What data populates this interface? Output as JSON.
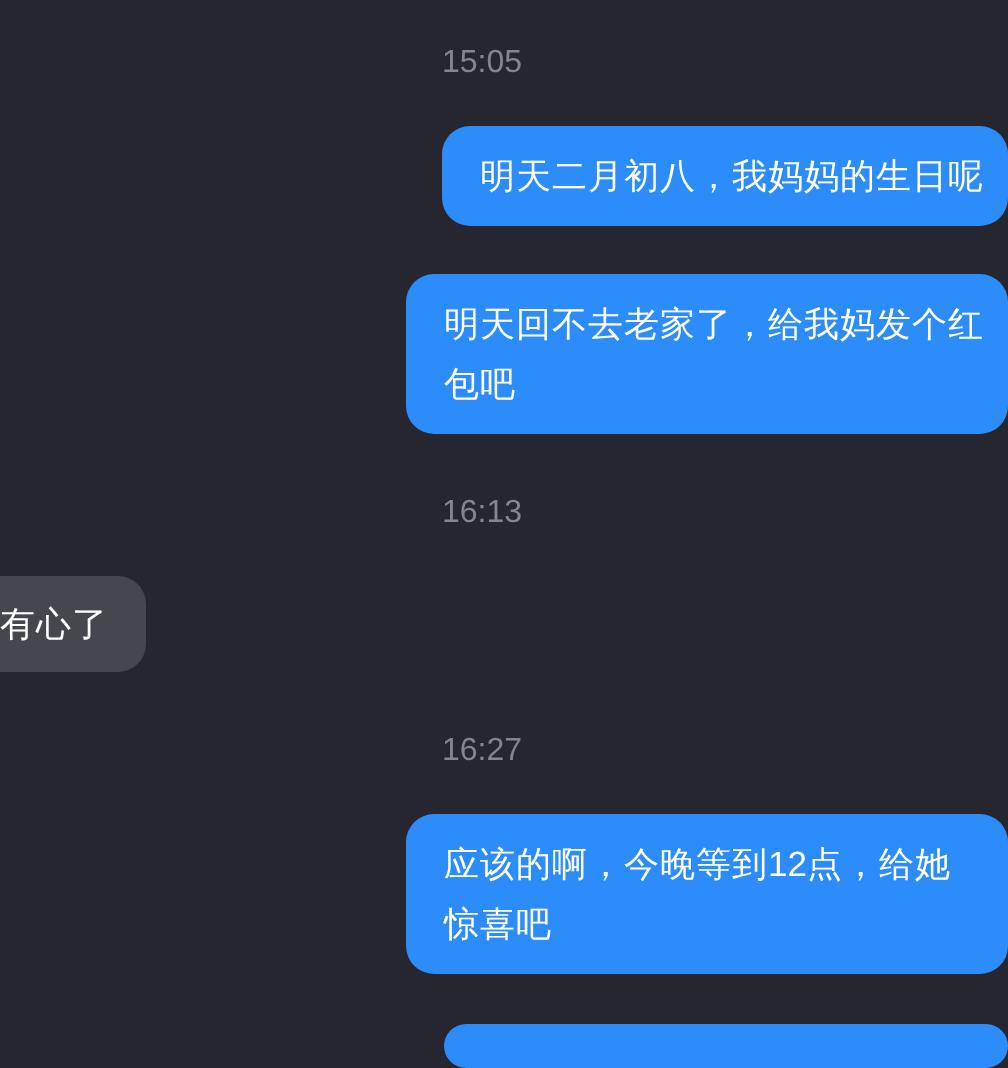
{
  "messages": [
    {
      "kind": "time",
      "text": "15:05"
    },
    {
      "kind": "sent",
      "text": "明天二月初八，我妈妈的生日呢"
    },
    {
      "kind": "sent",
      "text": "明天回不去老家了，给我妈发个红包吧"
    },
    {
      "kind": "time",
      "text": "16:13"
    },
    {
      "kind": "received",
      "text": "有心了"
    },
    {
      "kind": "time",
      "text": "16:27"
    },
    {
      "kind": "sent",
      "text": "应该的啊，今晚等到12点，给她惊喜吧"
    },
    {
      "kind": "sent-cut"
    }
  ]
}
